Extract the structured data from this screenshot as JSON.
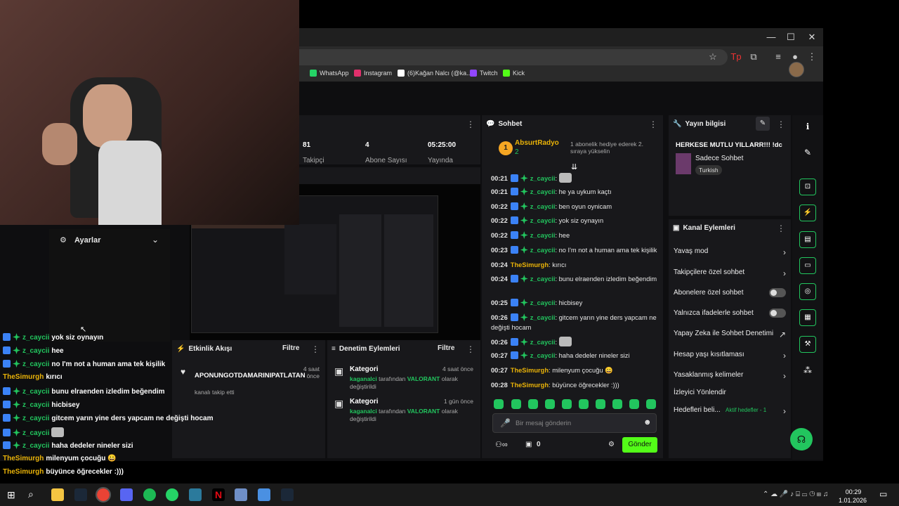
{
  "browser": {
    "window_controls": [
      "—",
      "☐",
      "✕"
    ],
    "bookmarks": [
      {
        "label": "WhatsApp",
        "color": "#25d366"
      },
      {
        "label": "Instagram",
        "color": "#e1306c"
      },
      {
        "label": "(6)Kağan Nalcı (@ka...",
        "color": "#ffffff"
      },
      {
        "label": "Twitch",
        "color": "#9146ff"
      },
      {
        "label": "Kick",
        "color": "#53fc18"
      }
    ]
  },
  "stats": [
    {
      "value": "81",
      "label": "Takipçi"
    },
    {
      "value": "4",
      "label": "Abone Sayısı"
    },
    {
      "value": "05:25:00",
      "label": "Yayında"
    }
  ],
  "chat": {
    "title": "Sohbet",
    "pinned_user": "AbsurtRadyo",
    "pinned_rank": "1",
    "pinned_count": "2",
    "pinned_text": "1 abonelik hediye ederek 2. sıraya yükselin",
    "messages": [
      {
        "time": "00:21",
        "user": "z_caycii",
        "text": "",
        "emote": true,
        "color": "g"
      },
      {
        "time": "00:21",
        "user": "z_caycii",
        "text": "he ya uykum kaçtı",
        "emote": false,
        "color": "g"
      },
      {
        "time": "00:22",
        "user": "z_caycii",
        "text": "ben oyun oynicam",
        "emote": false,
        "color": "g"
      },
      {
        "time": "00:22",
        "user": "z_caycii",
        "text": "yok siz oynayın",
        "emote": false,
        "color": "g"
      },
      {
        "time": "00:22",
        "user": "z_caycii",
        "text": "hee",
        "emote": false,
        "color": "g"
      },
      {
        "time": "00:23",
        "user": "z_caycii",
        "text": "no I'm not a human ama tek kişilik",
        "emote": false,
        "color": "g"
      },
      {
        "time": "00:24",
        "user": "TheSimurgh",
        "text": "kırıcı",
        "emote": false,
        "color": "y"
      },
      {
        "time": "00:24",
        "user": "z_caycii",
        "text": "bunu elraenden izledim beğendim",
        "emote": false,
        "color": "g"
      },
      {
        "time": "00:25",
        "user": "z_caycii",
        "text": "hicbisey",
        "emote": false,
        "color": "g"
      },
      {
        "time": "00:26",
        "user": "z_caycii",
        "text": "gitcem yarın yine ders yapcam ne değişti hocam",
        "emote": false,
        "color": "g"
      },
      {
        "time": "00:26",
        "user": "z_caycii",
        "text": "",
        "emote": true,
        "color": "g"
      },
      {
        "time": "00:27",
        "user": "z_caycii",
        "text": "haha dedeler nineler sizi",
        "emote": false,
        "color": "g"
      },
      {
        "time": "00:27",
        "user": "TheSimurgh",
        "text": "milenyum çocuğu 😀",
        "emote": false,
        "color": "y"
      },
      {
        "time": "00:28",
        "user": "TheSimurgh",
        "text": "büyünce öğrecekler :)))",
        "emote": false,
        "color": "y"
      }
    ],
    "input_placeholder": "Bir mesaj gönderin",
    "count": "0",
    "send_label": "Gönder"
  },
  "stream_info": {
    "title": "Yayın bilgisi",
    "stream_title": "HERKESE MUTLU YILLARR!!! !dc",
    "category": "Sadece Sohbet",
    "tag": "Turkish"
  },
  "channel_actions": {
    "title": "Kanal Eylemleri",
    "items": [
      {
        "label": "Yavaş mod",
        "control": "arrow"
      },
      {
        "label": "Takipçilere özel sohbet",
        "control": "arrow"
      },
      {
        "label": "Abonelere özel sohbet",
        "control": "toggle"
      },
      {
        "label": "Yalnızca ifadelerle sohbet",
        "control": "toggle"
      },
      {
        "label": "Yapay Zeka ile Sohbet Denetimi",
        "control": "external"
      },
      {
        "label": "Hesap yaşı kısıtlaması",
        "control": "arrow"
      },
      {
        "label": "Yasaklanmış kelimeler",
        "control": "arrow"
      },
      {
        "label": "İzleyici Yönlendir",
        "control": "none"
      },
      {
        "label": "Hedefleri beli...",
        "control": "arrow",
        "sub": "Aktif hedefler - 1"
      }
    ]
  },
  "activity": {
    "title": "Etkinlik Akışı",
    "filter": "Filtre",
    "user": "APONUNGOTDAMARINIPATLATAN",
    "time": "4 saat önce",
    "action": "kanalı takip etti"
  },
  "moderation": {
    "title": "Denetim Eylemleri",
    "filter": "Filtre",
    "items": [
      {
        "title": "Kategori",
        "time": "4 saat önce",
        "who": "kaganalci",
        "mid": " tarafından ",
        "game": "VALORANT",
        "end": " olarak değiştirildi"
      },
      {
        "title": "Kategori",
        "time": "1 gün önce",
        "who": "kaganalci",
        "mid": " tarafından ",
        "game": "VALORANT",
        "end": " olarak değiştirildi"
      }
    ]
  },
  "settings": {
    "title": "Ayarlar"
  },
  "overlay_chat": [
    {
      "user": "z_caycii",
      "text": "yok siz oynayın",
      "color": "g"
    },
    {
      "user": "z_caycii",
      "text": "hee",
      "color": "g"
    },
    {
      "user": "z_caycii",
      "text": "no I'm not a human ama tek kişilik",
      "color": "g"
    },
    {
      "user": "TheSimurgh",
      "text": "kırıcı",
      "color": "y"
    },
    {
      "user": "z_caycii",
      "text": "bunu elraenden izledim beğendim",
      "color": "g"
    },
    {
      "user": "z_caycii",
      "text": "hicbisey",
      "color": "g"
    },
    {
      "user": "z_caycii",
      "text": "gitcem yarın yine ders yapcam ne değişti hocam",
      "color": "g"
    },
    {
      "user": "z_caycii",
      "text": "",
      "color": "g"
    },
    {
      "user": "z_caycii",
      "text": "haha dedeler nineler sizi",
      "color": "g"
    },
    {
      "user": "TheSimurgh",
      "text": "milenyum çocuğu 😀",
      "color": "y"
    },
    {
      "user": "TheSimurgh",
      "text": "büyünce öğrecekler :)))",
      "color": "y"
    }
  ],
  "taskbar": {
    "time": "00:29",
    "date": "1.01.2026"
  },
  "colors": {
    "accent": "#53fc18",
    "green": "#22c55e",
    "yellow": "#eab308"
  }
}
